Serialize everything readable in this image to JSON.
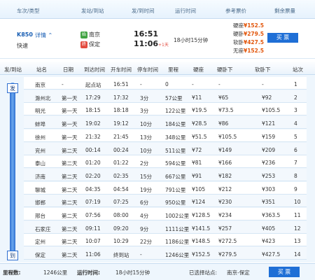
{
  "header": {
    "train_type_col": "车次/类型",
    "station_col": "发站/到站",
    "time_col": "发/到时间",
    "duration_col": "运行时间",
    "price_col": "参考票价",
    "remaining_col": "剩余票量"
  },
  "train": {
    "number": "K850",
    "detail_link": "详情",
    "detail_icon": "chevron-up-icon",
    "type": "快速",
    "from_station": "南京",
    "to_station": "保定",
    "from_icon_text": "始",
    "to_icon_text": "终",
    "dep_time": "16:51",
    "arr_time": "11:06",
    "next_day": "+1天",
    "duration": "18小时15分钟",
    "prices": [
      {
        "label": "硬座",
        "value": "¥152.5"
      },
      {
        "label": "硬卧",
        "value": "¥279.5"
      },
      {
        "label": "软卧",
        "value": "¥427.5"
      },
      {
        "label": "无座",
        "value": "¥152.5"
      }
    ],
    "buy_label": "买 票"
  },
  "stops_header": {
    "dir": "发/到站",
    "station": "站名",
    "day": "日期",
    "arrive": "到达时间",
    "depart": "开车时间",
    "stay": "停车时间",
    "mileage": "里程",
    "hard_seat": "硬座",
    "hard_sleeper": "硬卧下",
    "soft_sleeper": "软卧下",
    "stop_no": "站次"
  },
  "tags": {
    "start": "发",
    "end": "到"
  },
  "stops": [
    {
      "station": "南京",
      "day": "-",
      "arrive": "起点站",
      "depart": "16:51",
      "stay": "-",
      "mileage": "0",
      "hard_seat": "-",
      "hard_sleeper": "-",
      "soft_sleeper": "-",
      "no": "1"
    },
    {
      "station": "滁州北",
      "day": "第一天",
      "arrive": "17:29",
      "depart": "17:32",
      "stay": "3分",
      "mileage": "57公里",
      "hard_seat": "¥11",
      "hard_sleeper": "¥65",
      "soft_sleeper": "¥92",
      "no": "2"
    },
    {
      "station": "明光",
      "day": "第一天",
      "arrive": "18:15",
      "depart": "18:18",
      "stay": "3分",
      "mileage": "122公里",
      "hard_seat": "¥19.5",
      "hard_sleeper": "¥73.5",
      "soft_sleeper": "¥105.5",
      "no": "3"
    },
    {
      "station": "蚌埠",
      "day": "第一天",
      "arrive": "19:02",
      "depart": "19:12",
      "stay": "10分",
      "mileage": "184公里",
      "hard_seat": "¥28.5",
      "hard_sleeper": "¥86",
      "soft_sleeper": "¥121",
      "no": "4"
    },
    {
      "station": "徐州",
      "day": "第一天",
      "arrive": "21:32",
      "depart": "21:45",
      "stay": "13分",
      "mileage": "348公里",
      "hard_seat": "¥51.5",
      "hard_sleeper": "¥105.5",
      "soft_sleeper": "¥159",
      "no": "5"
    },
    {
      "station": "兖州",
      "day": "第二天",
      "arrive": "00:14",
      "depart": "00:24",
      "stay": "10分",
      "mileage": "511公里",
      "hard_seat": "¥72",
      "hard_sleeper": "¥149",
      "soft_sleeper": "¥209",
      "no": "6"
    },
    {
      "station": "泰山",
      "day": "第二天",
      "arrive": "01:20",
      "depart": "01:22",
      "stay": "2分",
      "mileage": "594公里",
      "hard_seat": "¥81",
      "hard_sleeper": "¥166",
      "soft_sleeper": "¥236",
      "no": "7"
    },
    {
      "station": "济南",
      "day": "第二天",
      "arrive": "02:20",
      "depart": "02:35",
      "stay": "15分",
      "mileage": "667公里",
      "hard_seat": "¥91",
      "hard_sleeper": "¥182",
      "soft_sleeper": "¥253",
      "no": "8"
    },
    {
      "station": "聊城",
      "day": "第二天",
      "arrive": "04:35",
      "depart": "04:54",
      "stay": "19分",
      "mileage": "791公里",
      "hard_seat": "¥105",
      "hard_sleeper": "¥212",
      "soft_sleeper": "¥303",
      "no": "9"
    },
    {
      "station": "邯郸",
      "day": "第二天",
      "arrive": "07:19",
      "depart": "07:25",
      "stay": "6分",
      "mileage": "950公里",
      "hard_seat": "¥124",
      "hard_sleeper": "¥230",
      "soft_sleeper": "¥351",
      "no": "10"
    },
    {
      "station": "邢台",
      "day": "第二天",
      "arrive": "07:56",
      "depart": "08:00",
      "stay": "4分",
      "mileage": "1002公里",
      "hard_seat": "¥128.5",
      "hard_sleeper": "¥234",
      "soft_sleeper": "¥363.5",
      "no": "11"
    },
    {
      "station": "石家庄",
      "day": "第二天",
      "arrive": "09:11",
      "depart": "09:20",
      "stay": "9分",
      "mileage": "1111公里",
      "hard_seat": "¥141.5",
      "hard_sleeper": "¥257",
      "soft_sleeper": "¥405",
      "no": "12"
    },
    {
      "station": "定州",
      "day": "第二天",
      "arrive": "10:07",
      "depart": "10:29",
      "stay": "22分",
      "mileage": "1186公里",
      "hard_seat": "¥148.5",
      "hard_sleeper": "¥272.5",
      "soft_sleeper": "¥423",
      "no": "13"
    },
    {
      "station": "保定",
      "day": "第二天",
      "arrive": "11:06",
      "depart": "终到站",
      "stay": "-",
      "mileage": "1246公里",
      "hard_seat": "¥152.5",
      "hard_sleeper": "¥279.5",
      "soft_sleeper": "¥427.5",
      "no": "14"
    }
  ],
  "footer": {
    "mileage_label": "里程数:",
    "mileage_value": "1246公里",
    "runtime_label": "运行时间:",
    "runtime_value": "18小时15分钟",
    "selected_label": "已选择站点:",
    "selected_value": "南京-保定",
    "buy_label": "买 票"
  }
}
